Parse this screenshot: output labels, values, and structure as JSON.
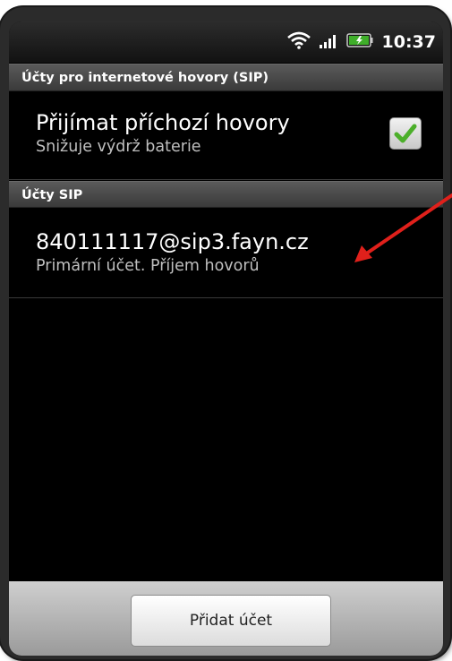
{
  "status_bar": {
    "time": "10:37",
    "icons": [
      "wifi-icon",
      "signal-icon",
      "battery-icon"
    ]
  },
  "header": {
    "title": "Účty pro internetové hovory (SIP)"
  },
  "incoming_calls": {
    "title": "Přijímat příchozí hovory",
    "summary": "Snižuje výdrž baterie",
    "checked": true
  },
  "sip_section": {
    "title": "Účty SIP"
  },
  "account": {
    "address": "840111117@sip3.fayn.cz",
    "summary": "Primární účet. Příjem hovorů"
  },
  "bottom_bar": {
    "add_label": "Přidat účet"
  },
  "colors": {
    "arrow": "#e0201b",
    "check": "#4caf2a",
    "header_bg": "#4a4a4a"
  }
}
